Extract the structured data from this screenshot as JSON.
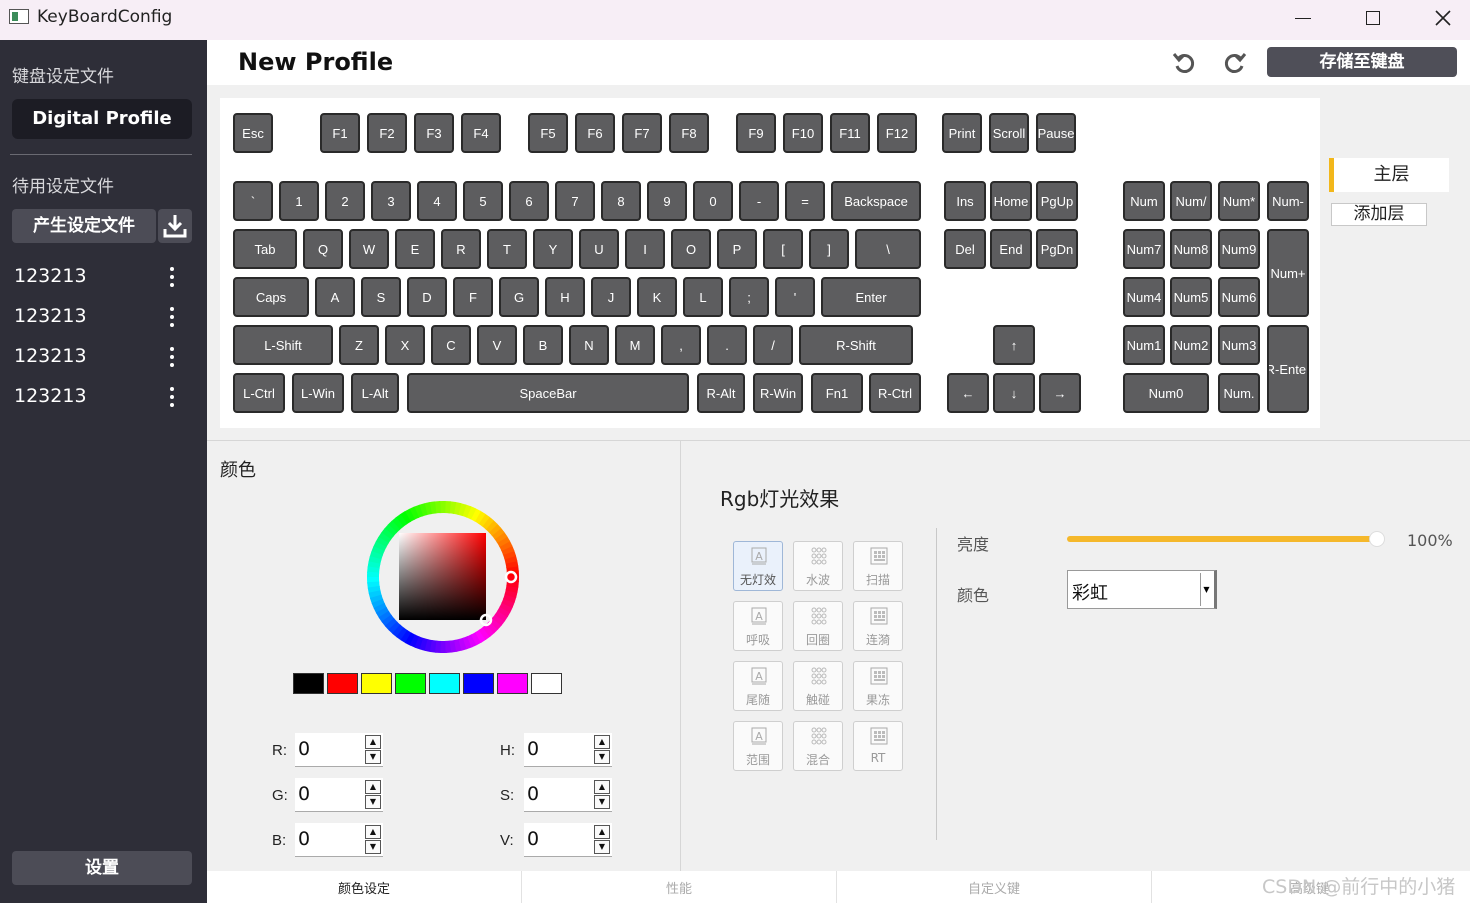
{
  "window": {
    "title": "KeyBoardConfig"
  },
  "sidebar": {
    "profiles_heading": "键盘设定文件",
    "current_profile": "Digital Profile",
    "pending_heading": "待用设定文件",
    "generate_label": "产生设定文件",
    "profiles": [
      {
        "name": "123213"
      },
      {
        "name": "123213"
      },
      {
        "name": "123213"
      },
      {
        "name": "123213"
      }
    ],
    "settings_label": "设置"
  },
  "header": {
    "title": "New Profile",
    "save_label": "存储至键盘"
  },
  "keyboard": {
    "keys": [
      "Esc",
      "F1",
      "F2",
      "F3",
      "F4",
      "F5",
      "F6",
      "F7",
      "F8",
      "F9",
      "F10",
      "F11",
      "F12",
      "Print",
      "Scroll",
      "Pause",
      "`",
      "1",
      "2",
      "3",
      "4",
      "5",
      "6",
      "7",
      "8",
      "9",
      "0",
      "-",
      "=",
      "Backspace",
      "Tab",
      "Q",
      "W",
      "E",
      "R",
      "T",
      "Y",
      "U",
      "I",
      "O",
      "P",
      "[",
      "]",
      "\\",
      "Caps",
      "A",
      "S",
      "D",
      "F",
      "G",
      "H",
      "J",
      "K",
      "L",
      ";",
      "'",
      "Enter",
      "L-Shift",
      "Z",
      "X",
      "C",
      "V",
      "B",
      "N",
      "M",
      ",",
      ".",
      "/",
      "R-Shift",
      "L-Ctrl",
      "L-Win",
      "L-Alt",
      "SpaceBar",
      "R-Alt",
      "R-Win",
      "Fn1",
      "R-Ctrl",
      "Ins",
      "Home",
      "PgUp",
      "Del",
      "End",
      "PgDn",
      "↑",
      "←",
      "↓",
      "→",
      "Num",
      "Num/",
      "Num*",
      "Num-",
      "Num7",
      "Num8",
      "Num9",
      "Num+",
      "Num4",
      "Num5",
      "Num6",
      "Num1",
      "Num2",
      "Num3",
      "R-Enter",
      "Num0",
      "Num."
    ]
  },
  "layers": {
    "main_label": "主层",
    "add_label": "添加层",
    "accent": "#f2b71b"
  },
  "color_panel": {
    "title": "颜色",
    "swatches": [
      "#000000",
      "#ff0000",
      "#ffff00",
      "#00ff00",
      "#00ffff",
      "#0000ff",
      "#ff00ff",
      "#ffffff"
    ],
    "fields": {
      "r": {
        "label": "R:",
        "value": "0"
      },
      "g": {
        "label": "G:",
        "value": "0"
      },
      "b": {
        "label": "B:",
        "value": "0"
      },
      "h": {
        "label": "H:",
        "value": "0"
      },
      "s": {
        "label": "S:",
        "value": "0"
      },
      "v": {
        "label": "V:",
        "value": "0"
      }
    }
  },
  "rgb_panel": {
    "title": "Rgb灯光效果",
    "effects": [
      {
        "label": "无灯效",
        "icon": "letter-a-icon",
        "active": true
      },
      {
        "label": "水波",
        "icon": "dot-grid-icon"
      },
      {
        "label": "扫描",
        "icon": "keyboard-icon"
      },
      {
        "label": "呼吸",
        "icon": "letter-a-icon"
      },
      {
        "label": "回圈",
        "icon": "dot-grid-icon"
      },
      {
        "label": "连漪",
        "icon": "keyboard-icon"
      },
      {
        "label": "尾随",
        "icon": "letter-a-icon"
      },
      {
        "label": "触碰",
        "icon": "dot-grid-icon"
      },
      {
        "label": "果冻",
        "icon": "keyboard-icon"
      },
      {
        "label": "范围",
        "icon": "letter-a-icon"
      },
      {
        "label": "混合",
        "icon": "dot-grid-icon"
      },
      {
        "label": "RT",
        "icon": "keyboard-icon"
      }
    ],
    "brightness_label": "亮度",
    "brightness_value": "100%",
    "brightness_level": 1.0,
    "color_label": "颜色",
    "color_value": "彩虹"
  },
  "tabs": [
    {
      "label": "颜色设定",
      "active": true
    },
    {
      "label": "性能"
    },
    {
      "label": "自定义键"
    },
    {
      "label": "高级键"
    }
  ],
  "watermark": "CSDN @前行中的小猪"
}
